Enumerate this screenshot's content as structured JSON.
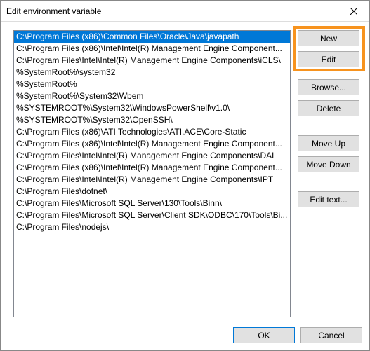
{
  "window": {
    "title": "Edit environment variable"
  },
  "list": {
    "items": [
      "C:\\Program Files (x86)\\Common Files\\Oracle\\Java\\javapath",
      "C:\\Program Files (x86)\\Intel\\Intel(R) Management Engine Component...",
      "C:\\Program Files\\Intel\\Intel(R) Management Engine Components\\iCLS\\",
      "%SystemRoot%\\system32",
      "%SystemRoot%",
      "%SystemRoot%\\System32\\Wbem",
      "%SYSTEMROOT%\\System32\\WindowsPowerShell\\v1.0\\",
      "%SYSTEMROOT%\\System32\\OpenSSH\\",
      "C:\\Program Files (x86)\\ATI Technologies\\ATI.ACE\\Core-Static",
      "C:\\Program Files (x86)\\Intel\\Intel(R) Management Engine Component...",
      "C:\\Program Files\\Intel\\Intel(R) Management Engine Components\\DAL",
      "C:\\Program Files (x86)\\Intel\\Intel(R) Management Engine Component...",
      "C:\\Program Files\\Intel\\Intel(R) Management Engine Components\\IPT",
      "C:\\Program Files\\dotnet\\",
      "C:\\Program Files\\Microsoft SQL Server\\130\\Tools\\Binn\\",
      "C:\\Program Files\\Microsoft SQL Server\\Client SDK\\ODBC\\170\\Tools\\Bi...",
      "C:\\Program Files\\nodejs\\"
    ],
    "selected_index": 0
  },
  "buttons": {
    "new": "New",
    "edit": "Edit",
    "browse": "Browse...",
    "delete": "Delete",
    "move_up": "Move Up",
    "move_down": "Move Down",
    "edit_text": "Edit text...",
    "ok": "OK",
    "cancel": "Cancel"
  }
}
